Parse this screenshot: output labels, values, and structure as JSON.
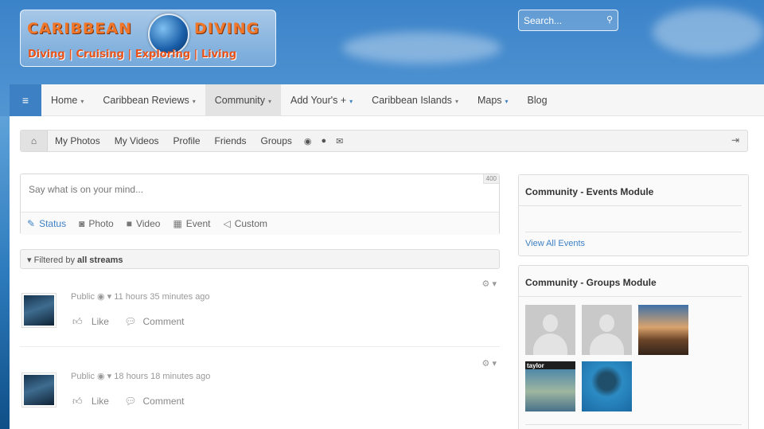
{
  "logo": {
    "left_text": "CARIBBEAN",
    "right_text": "DIVING",
    "tagline": "Diving | Cruising | Exploring | Living"
  },
  "search": {
    "placeholder": "Search..."
  },
  "nav": {
    "menu_icon": "≡",
    "items": [
      {
        "label": "Home",
        "caret": "▾"
      },
      {
        "label": "Caribbean Reviews",
        "caret": "▾"
      },
      {
        "label": "Community",
        "caret": "▾"
      },
      {
        "label": "Add Your's +",
        "caret": "▾"
      },
      {
        "label": "Caribbean Islands",
        "caret": "▾"
      },
      {
        "label": "Maps",
        "caret": "▾"
      },
      {
        "label": "Blog",
        "caret": ""
      }
    ]
  },
  "toolbar": {
    "links": [
      "My Photos",
      "My Videos",
      "Profile",
      "Friends",
      "Groups"
    ]
  },
  "composer": {
    "placeholder": "Say what is on your mind...",
    "char_count": "400",
    "tabs": [
      "Status",
      "Photo",
      "Video",
      "Event",
      "Custom"
    ]
  },
  "filter": {
    "prefix": "Filtered by",
    "value": "all streams"
  },
  "posts": [
    {
      "privacy": "Public",
      "time": "11 hours 35 minutes ago",
      "like": "Like",
      "comment": "Comment"
    },
    {
      "privacy": "Public",
      "time": "18 hours 18 minutes ago",
      "like": "Like",
      "comment": "Comment"
    }
  ],
  "events_module": {
    "title": "Community - Events Module",
    "link": "View All Events"
  },
  "groups_module": {
    "title": "Community - Groups Module",
    "thumb_caption": "taylor"
  },
  "colors": {
    "accent": "#3d80c3",
    "logo_orange": "#f0772a"
  }
}
